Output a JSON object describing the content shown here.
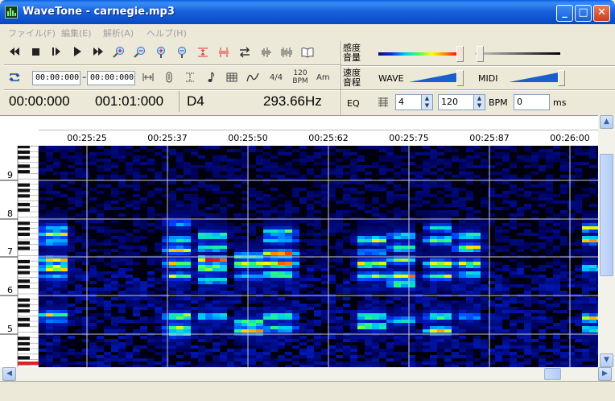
{
  "window": {
    "title": "WaveTone - carnegie.mp3"
  },
  "menu": [
    {
      "label": "ファイル(F)"
    },
    {
      "label": "編集(E)"
    },
    {
      "label": "解析(A)"
    },
    {
      "label": "ヘルプ(H)"
    }
  ],
  "toolbar": {
    "range_start": "00:00:000",
    "range_sep": "–",
    "range_end": "00:00:000",
    "meter": "4/4",
    "bpm_top": "120",
    "bpm_bottom": "BPM",
    "key": "Am"
  },
  "status": {
    "position": "00:00:000",
    "measure": "001:01:000",
    "note": "D4",
    "frequency": "293.66Hz",
    "eq": "EQ"
  },
  "right_panel": {
    "sensitivity_label_1": "感度",
    "sensitivity_label_2": "音量",
    "speed_label_1": "速度",
    "speed_label_2": "音程",
    "wave_label": "WAVE",
    "midi_label": "MIDI",
    "beats_value": "4",
    "tempo_value": "120",
    "bpm_label": "BPM",
    "offset_value": "0",
    "ms_label": "ms"
  },
  "timeline": {
    "ticks": [
      "00:25:25",
      "00:25:37",
      "00:25:50",
      "00:25:62",
      "00:25:75",
      "00:25:87",
      "00:26:00"
    ]
  },
  "octaves": [
    "9",
    "8",
    "7",
    "6",
    "5"
  ],
  "colors": {
    "title_blue": "#0c52cc",
    "spectrum_bg": "#000010",
    "grid": "#c8c8d0"
  }
}
